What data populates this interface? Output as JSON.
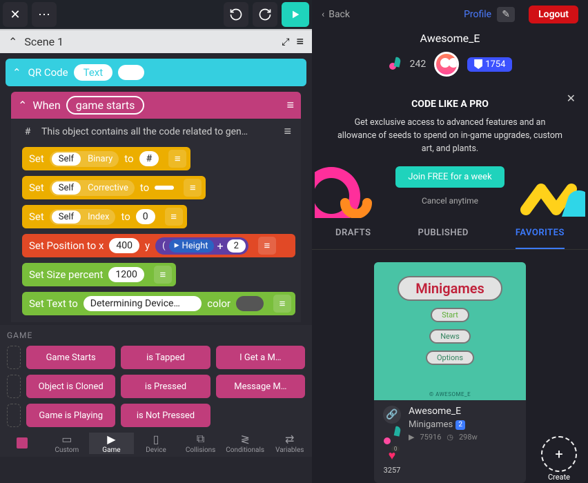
{
  "left": {
    "scene_title": "Scene 1",
    "object": {
      "name": "QR Code",
      "text_label": "Text"
    },
    "rule": {
      "when": "When",
      "condition": "game starts"
    },
    "comment": "This object contains all the code related to gen…",
    "blocks": {
      "set_label": "Set",
      "self": "Self",
      "bin": "Binary",
      "to": "to",
      "hash": "#",
      "corr": "Corrective",
      "idx": "Index",
      "zero": "0",
      "pos": "Set Position to x",
      "x": "400",
      "y_label": "y",
      "height": "Height",
      "plus_num": "2",
      "size": "Set Size percent",
      "size_val": "1200",
      "settext": "Set Text to",
      "text_val": "Determining Device…",
      "color_label": "color"
    },
    "game_panel": {
      "label": "GAME",
      "events": [
        "Game Starts",
        "is Tapped",
        "I Get a M…",
        "Object is Cloned",
        "is Pressed",
        "Message M…",
        "Game is Playing",
        "is Not Pressed"
      ]
    },
    "bottom": [
      "Custom",
      "Game",
      "Device",
      "Collisions",
      "Conditionals",
      "Variables"
    ]
  },
  "right": {
    "back": "Back",
    "profile_link": "Profile",
    "logout": "Logout",
    "username": "Awesome_E",
    "seeds": "242",
    "badge_num": "1754",
    "promo": {
      "title": "CODE LIKE A PRO",
      "desc": "Get exclusive access to advanced features and an allowance of seeds to spend on in-game upgrades, custom art, and plants.",
      "cta": "Join FREE for a week",
      "cancel": "Cancel anytime"
    },
    "tabs": {
      "drafts": "DRAFTS",
      "published": "PUBLISHED",
      "favorites": "FAVORITES"
    },
    "project": {
      "thumb_title": "Minigames",
      "start": "Start",
      "news": "News",
      "options": "Options",
      "footer": "© AWESOME_E",
      "author": "Awesome_E",
      "name": "Minigames",
      "badge": "2",
      "likes": "3257",
      "plays": "75916",
      "ago": "298w",
      "zero_badge": "0"
    },
    "create": "Create"
  }
}
